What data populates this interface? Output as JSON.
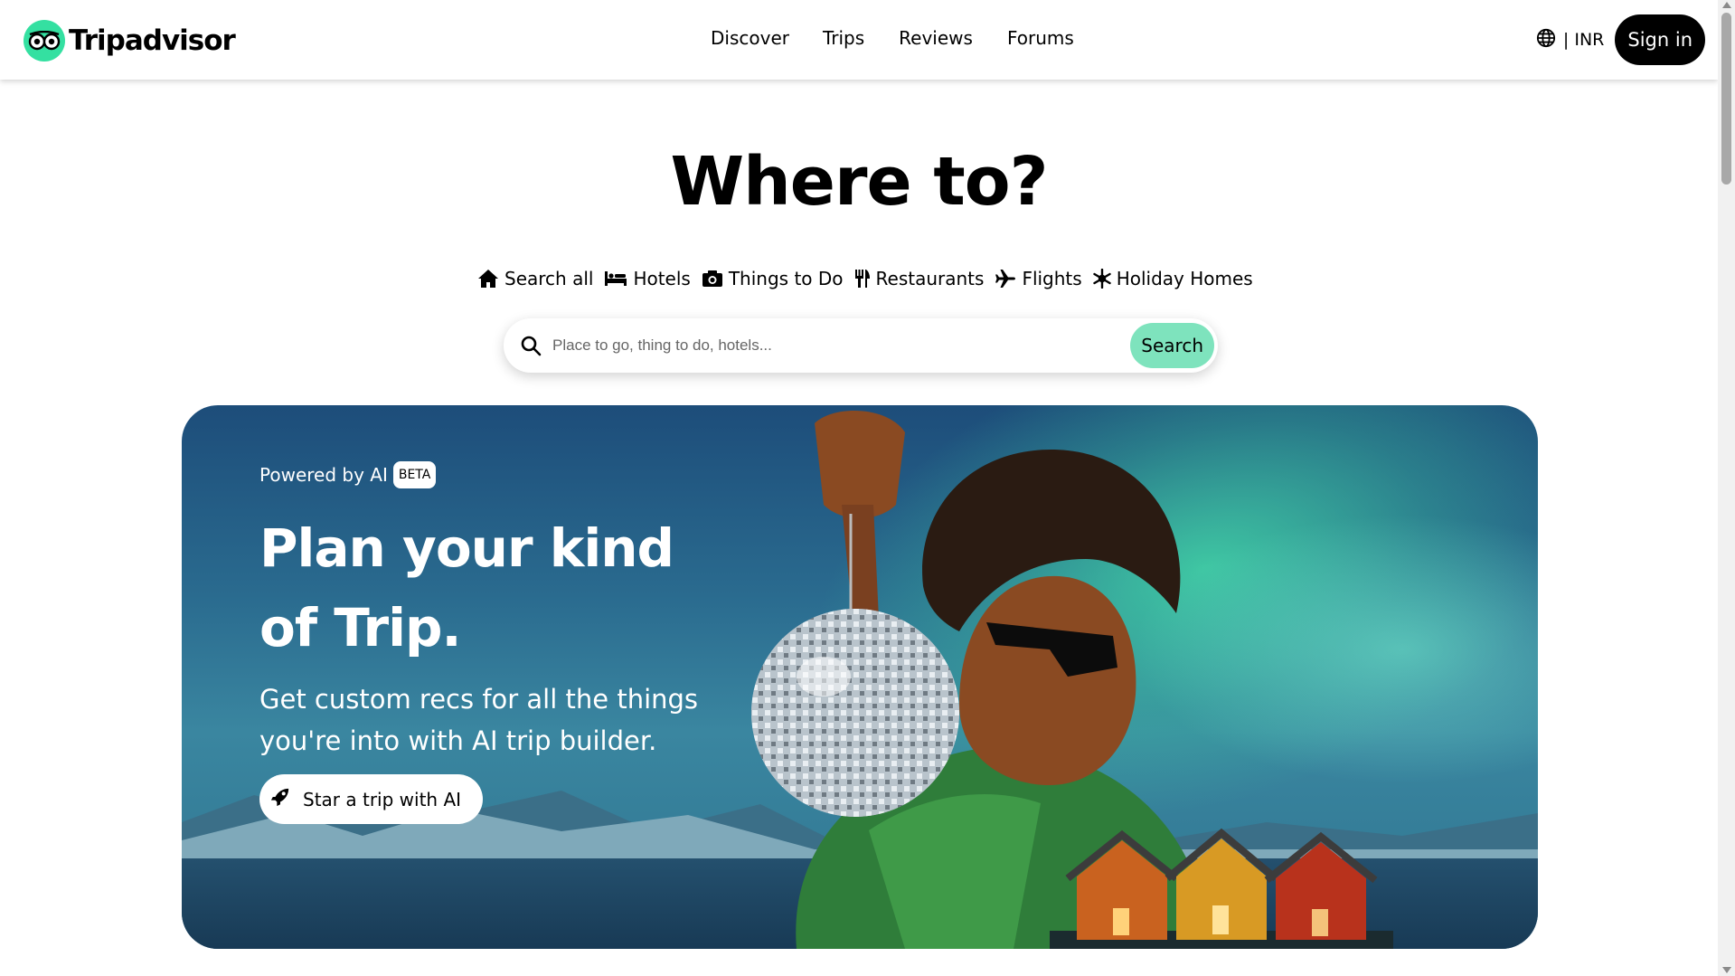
{
  "header": {
    "logo_text": "Tripadvisor",
    "nav": [
      "Discover",
      "Trips",
      "Reviews",
      "Forums"
    ],
    "currency": "| INR",
    "sign_in": "Sign in"
  },
  "hero": {
    "title": "Where to?",
    "tabs": [
      {
        "label": "Search all",
        "icon": "home-icon"
      },
      {
        "label": "Hotels",
        "icon": "bed-icon"
      },
      {
        "label": "Things to Do",
        "icon": "camera-icon"
      },
      {
        "label": "Restaurants",
        "icon": "fork-knife-icon"
      },
      {
        "label": "Flights",
        "icon": "plane-icon"
      },
      {
        "label": "Holiday Homes",
        "icon": "snowflake-icon"
      }
    ],
    "search": {
      "placeholder": "Place to go, thing to do, hotels...",
      "button": "Search"
    }
  },
  "banner": {
    "powered_by": "Powered by AI",
    "badge": "BETA",
    "headline": "Plan your kind of Trip.",
    "subtext": "Get custom recs for all the things you're into with AI trip builder.",
    "cta": "Star a trip with AI"
  },
  "colors": {
    "brand_green": "#34e0a1",
    "search_button": "#7ee3bd",
    "sign_in_bg": "#000000"
  }
}
